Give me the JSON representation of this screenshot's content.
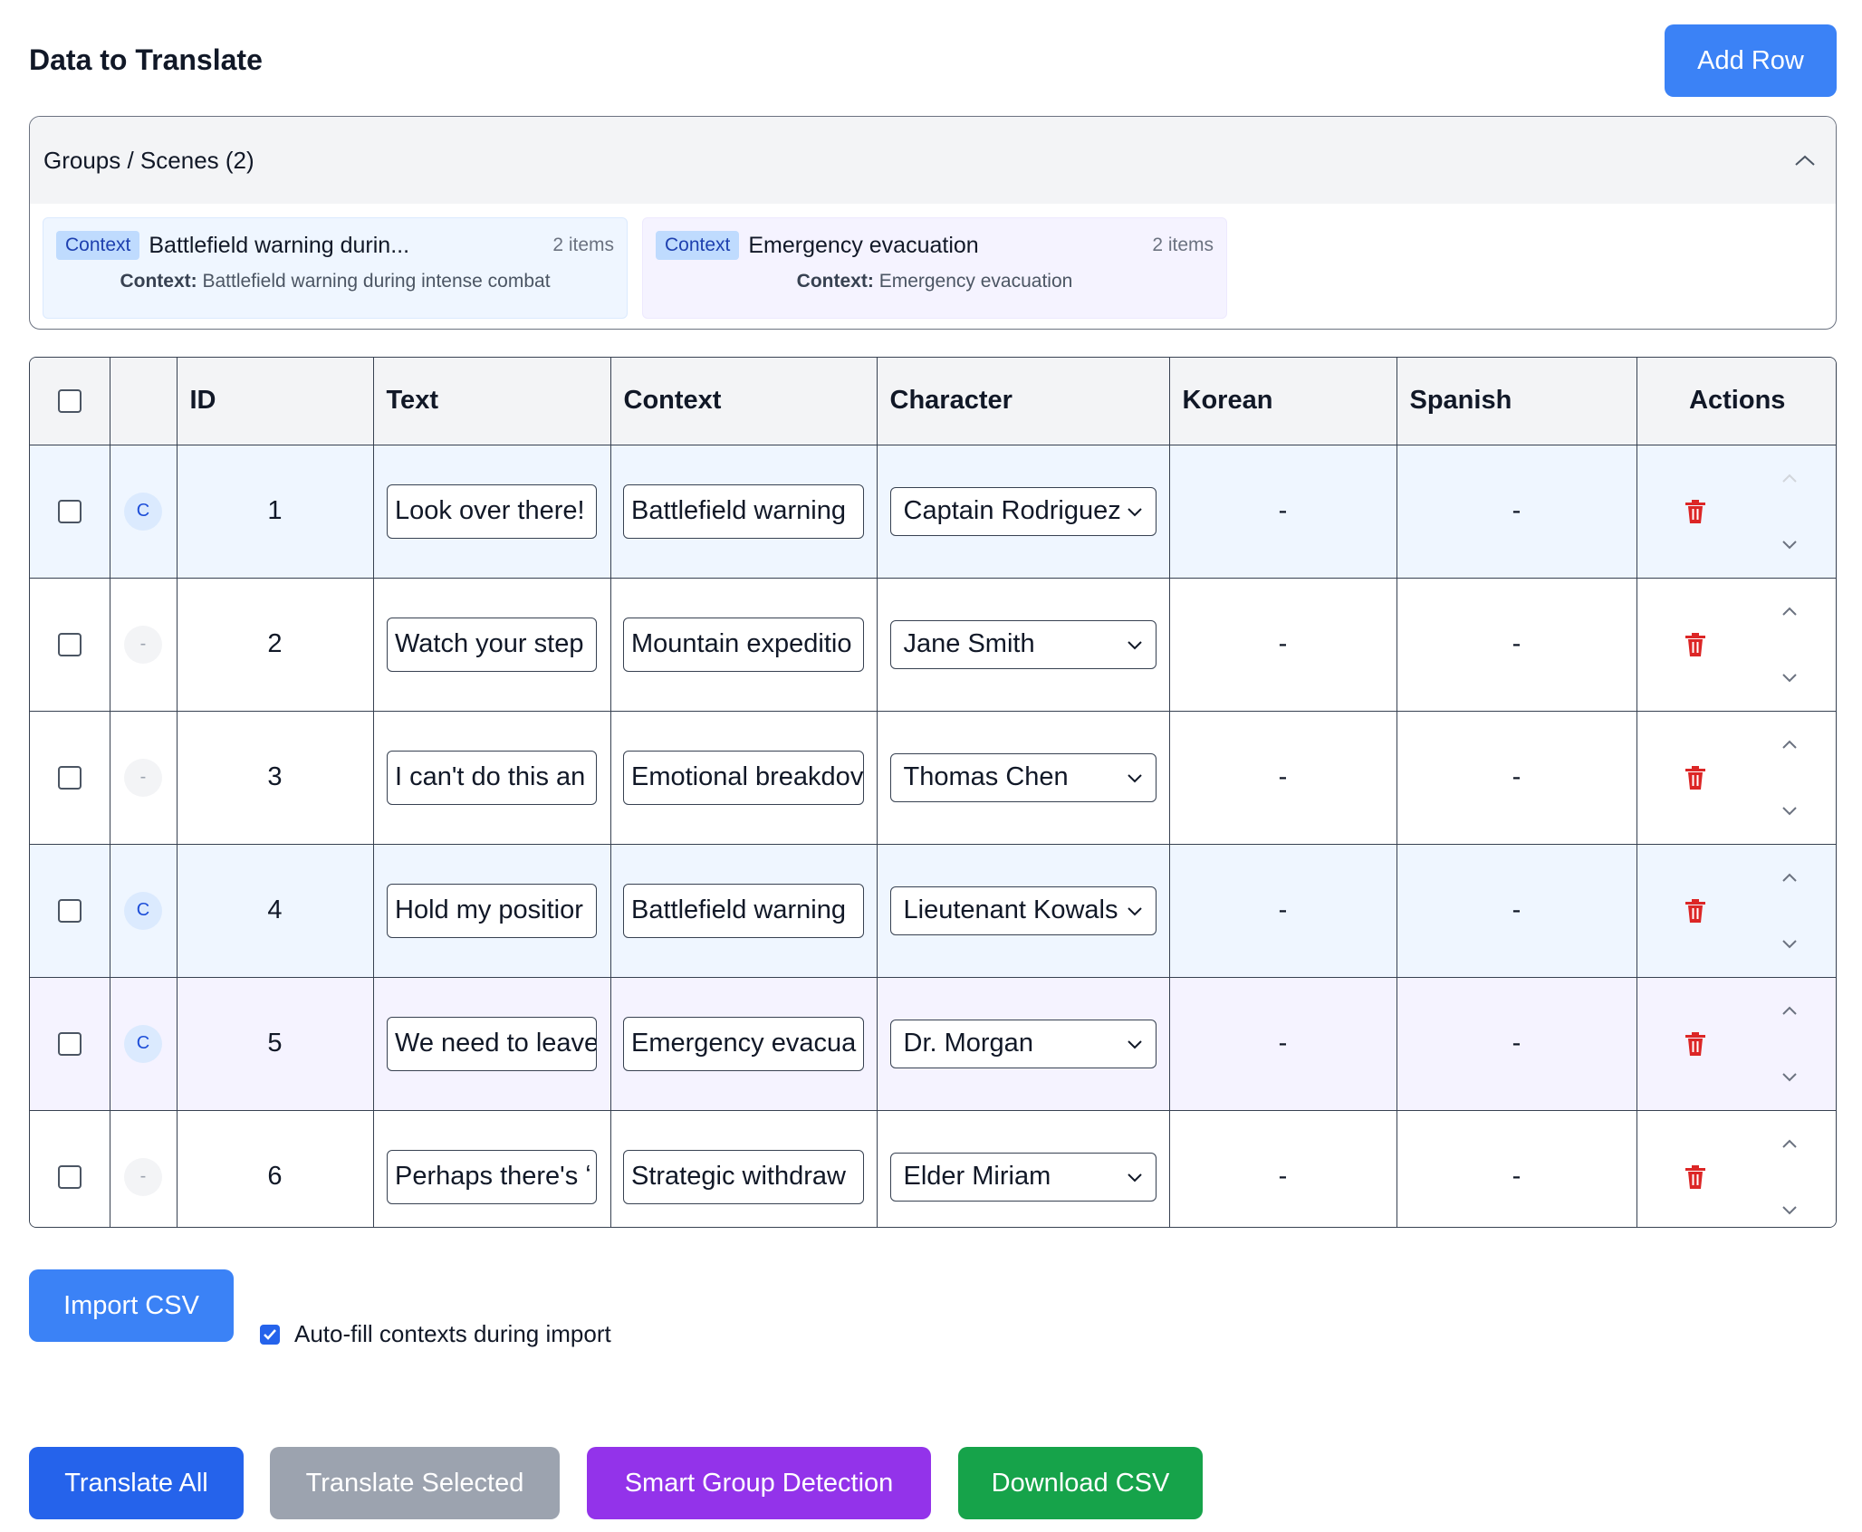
{
  "header": {
    "title": "Data to Translate",
    "add_row_label": "Add Row"
  },
  "groups": {
    "heading": "Groups / Scenes (2)",
    "items": [
      {
        "tag": "Context",
        "name": "Battlefield warning durin...",
        "count": "2 items",
        "context_label": "Context:",
        "context_value": "Battlefield warning during intense combat"
      },
      {
        "tag": "Context",
        "name": "Emergency evacuation",
        "count": "2 items",
        "context_label": "Context:",
        "context_value": "Emergency evacuation"
      }
    ]
  },
  "table": {
    "columns": {
      "id": "ID",
      "text": "Text",
      "context": "Context",
      "character": "Character",
      "korean": "Korean",
      "spanish": "Spanish",
      "actions": "Actions"
    },
    "rows": [
      {
        "badge": "C",
        "id": "1",
        "text": "Look over there!",
        "context": "Battlefield warning",
        "character": "Captain Rodriguez",
        "korean": "-",
        "spanish": "-"
      },
      {
        "badge": "-",
        "id": "2",
        "text": "Watch your step",
        "context": "Mountain expeditio",
        "character": "Jane Smith",
        "korean": "-",
        "spanish": "-"
      },
      {
        "badge": "-",
        "id": "3",
        "text": "I can't do this an",
        "context": "Emotional breakdov",
        "character": "Thomas Chen",
        "korean": "-",
        "spanish": "-"
      },
      {
        "badge": "C",
        "id": "4",
        "text": "Hold my positior",
        "context": "Battlefield warning",
        "character": "Lieutenant Kowals",
        "korean": "-",
        "spanish": "-"
      },
      {
        "badge": "C",
        "id": "5",
        "text": "We need to leave",
        "context": "Emergency evacua",
        "character": "Dr. Morgan",
        "korean": "-",
        "spanish": "-"
      },
      {
        "badge": "-",
        "id": "6",
        "text": "Perhaps there's ʻ",
        "context": "Strategic withdraw",
        "character": "Elder Miriam",
        "korean": "-",
        "spanish": "-"
      }
    ]
  },
  "import": {
    "button_label": "Import CSV",
    "autofill_label": "Auto-fill contexts during import",
    "autofill_checked": true
  },
  "footer": {
    "translate_all": "Translate All",
    "translate_selected": "Translate Selected",
    "smart_group": "Smart Group Detection",
    "download_csv": "Download CSV"
  },
  "colors": {
    "primary": "#3b82f6",
    "primary_dark": "#2563eb",
    "disabled": "#9ca3af",
    "purple": "#9333ea",
    "green": "#16a34a",
    "delete": "#dc2626"
  }
}
